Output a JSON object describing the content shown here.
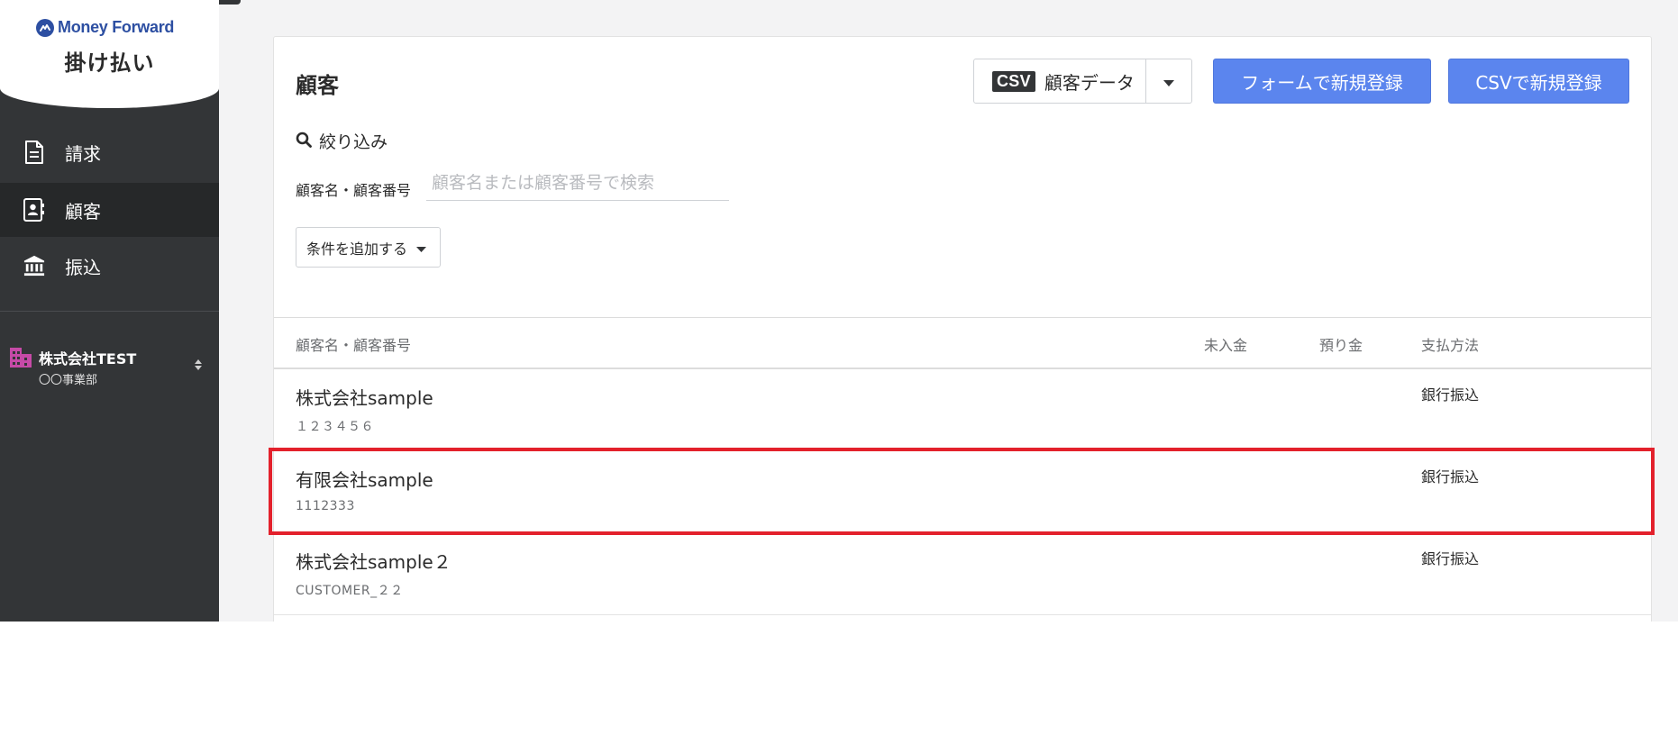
{
  "sidebar": {
    "brand": "Money Forward",
    "product": "掛け払い",
    "items": [
      {
        "label": "請求",
        "icon": "document-icon"
      },
      {
        "label": "顧客",
        "icon": "contact-card-icon"
      },
      {
        "label": "振込",
        "icon": "bank-icon"
      }
    ],
    "company": {
      "name": "株式会社TEST",
      "department": "〇〇事業部"
    }
  },
  "header": {
    "title": "顧客",
    "csv_badge": "CSV",
    "csv_label": "顧客データ",
    "form_register": "フォームで新規登録",
    "csv_register": "CSVで新規登録"
  },
  "filter": {
    "heading": "絞り込み",
    "field_label": "顧客名・顧客番号",
    "placeholder": "顧客名または顧客番号で検索",
    "add_condition": "条件を追加する"
  },
  "table": {
    "headers": [
      "顧客名・顧客番号",
      "未入金",
      "預り金",
      "支払方法"
    ],
    "rows": [
      {
        "name": "株式会社sample",
        "code": "１２３４５６",
        "unpaid": "",
        "deposit": "",
        "method": "銀行振込"
      },
      {
        "name": "有限会社sample",
        "code": "1112333",
        "unpaid": "",
        "deposit": "",
        "method": "銀行振込"
      },
      {
        "name": "株式会社sample２",
        "code": "CUSTOMER_２２",
        "unpaid": "",
        "deposit": "",
        "method": "銀行振込"
      }
    ]
  },
  "colors": {
    "sidebar": "#333537",
    "sidebar_active": "#262829",
    "primary": "#5b85ee",
    "brand": "#2d4fa2",
    "highlight": "#e3212c"
  }
}
